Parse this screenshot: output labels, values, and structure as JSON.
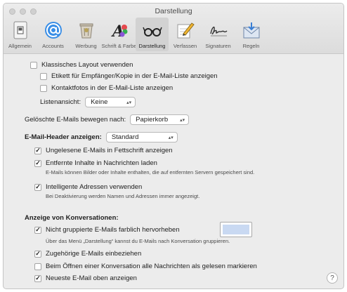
{
  "window": {
    "title": "Darstellung"
  },
  "toolbar": {
    "items": [
      {
        "label": "Allgemein",
        "icon": "switch-icon"
      },
      {
        "label": "Accounts",
        "icon": "at-icon"
      },
      {
        "label": "Werbung",
        "icon": "trash-icon"
      },
      {
        "label": "Schrift & Farbe",
        "icon": "font-color-icon"
      },
      {
        "label": "Darstellung",
        "icon": "glasses-icon",
        "active": true
      },
      {
        "label": "Verfassen",
        "icon": "pencil-icon"
      },
      {
        "label": "Signaturen",
        "icon": "signature-icon"
      },
      {
        "label": "Regeln",
        "icon": "envelope-icon"
      }
    ]
  },
  "layout": {
    "classic_label": "Klassisches Layout verwenden",
    "classic_checked": false,
    "label_recipient": "Etikett für Empfänger/Kopie in der E-Mail-Liste anzeigen",
    "label_recipient_checked": false,
    "contact_photos": "Kontaktfotos in der E-Mail-Liste anzeigen",
    "contact_photos_checked": false,
    "list_view_label": "Listenansicht:",
    "list_view_value": "Keine"
  },
  "deleted": {
    "label": "Gelöschte E-Mails bewegen nach:",
    "value": "Papierkorb"
  },
  "header": {
    "label": "E-Mail-Header anzeigen:",
    "value": "Standard"
  },
  "options": {
    "unread_bold": "Ungelesene E-Mails in Fettschrift anzeigen",
    "unread_bold_checked": true,
    "load_remote": "Entfernte Inhalte in Nachrichten laden",
    "load_remote_checked": true,
    "load_remote_sub": "E-Mails können Bilder oder Inhalte enthalten, die auf entfernten Servern gespeichert sind.",
    "smart_addresses": "Intelligente Adressen verwenden",
    "smart_addresses_checked": true,
    "smart_addresses_sub": "Bei Deaktivierung werden Namen und Adressen immer angezeigt."
  },
  "conversations": {
    "heading": "Anzeige von Konversationen:",
    "highlight": "Nicht gruppierte E-Mails farblich hervorheben",
    "highlight_checked": true,
    "highlight_color": "#c9d9f2",
    "highlight_sub": "Über das Menü „Darstellung“ kannst du E-Mails nach Konversation gruppieren.",
    "related": "Zugehörige E-Mails einbeziehen",
    "related_checked": true,
    "mark_read": "Beim Öffnen einer Konversation alle Nachrichten als gelesen markieren",
    "mark_read_checked": false,
    "newest_top": "Neueste E-Mail oben anzeigen",
    "newest_top_checked": true
  },
  "help": {
    "label": "?"
  },
  "checkmark": "✓"
}
